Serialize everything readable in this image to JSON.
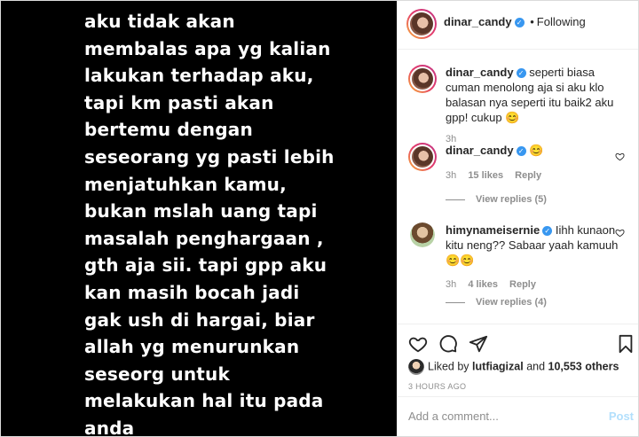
{
  "photo": {
    "lines": [
      "aku tidak akan",
      "membalas apa yg kalian",
      "lakukan terhadap aku,",
      "tapi km pasti akan",
      "bertemu dengan",
      "seseorang yg pasti lebih",
      "menjatuhkan kamu,",
      "bukan mslah uang tapi",
      "masalah penghargaan ,",
      "gth aja sii. tapi gpp aku",
      "kan masih bocah jadi",
      "gak ush di hargai, biar",
      "allah yg menurunkan",
      "seseorg untuk",
      "melakukan hal itu pada",
      "anda"
    ]
  },
  "header": {
    "username": "dinar_candy",
    "verified_mark": "✓",
    "separator": "•",
    "follow_status": "Following"
  },
  "comments": [
    {
      "username": "dinar_candy",
      "verified_mark": "✓",
      "text": "seperti biasa cuman menolong aja si aku klo balasan nya seperti itu baik2 aku gpp! cukup 😊",
      "time": "3h"
    },
    {
      "username": "dinar_candy",
      "verified_mark": "✓",
      "text": "😊",
      "time": "3h",
      "likes": "15 likes",
      "reply": "Reply",
      "view_replies": "View replies (5)"
    },
    {
      "username": "himynameisernie",
      "verified_mark": "✓",
      "text": "Iihh kunaon kitu neng?? Sabaar yaah kamuuh 😊😊",
      "time": "3h",
      "likes": "4 likes",
      "reply": "Reply",
      "view_replies": "View replies (4)"
    }
  ],
  "likes": {
    "prefix": "Liked by",
    "user": "lutfiagizal",
    "connector": "and",
    "others": "10,553 others"
  },
  "time_ago": "3 HOURS AGO",
  "add_comment": {
    "placeholder": "Add a comment...",
    "post_label": "Post"
  },
  "icons": [
    "heart-icon",
    "comment-icon",
    "share-icon",
    "bookmark-icon",
    "verified-badge-icon"
  ],
  "colors": {
    "verified": "#3897f0",
    "muted": "#8e8e8e",
    "post_disabled": "#b2dffc"
  }
}
